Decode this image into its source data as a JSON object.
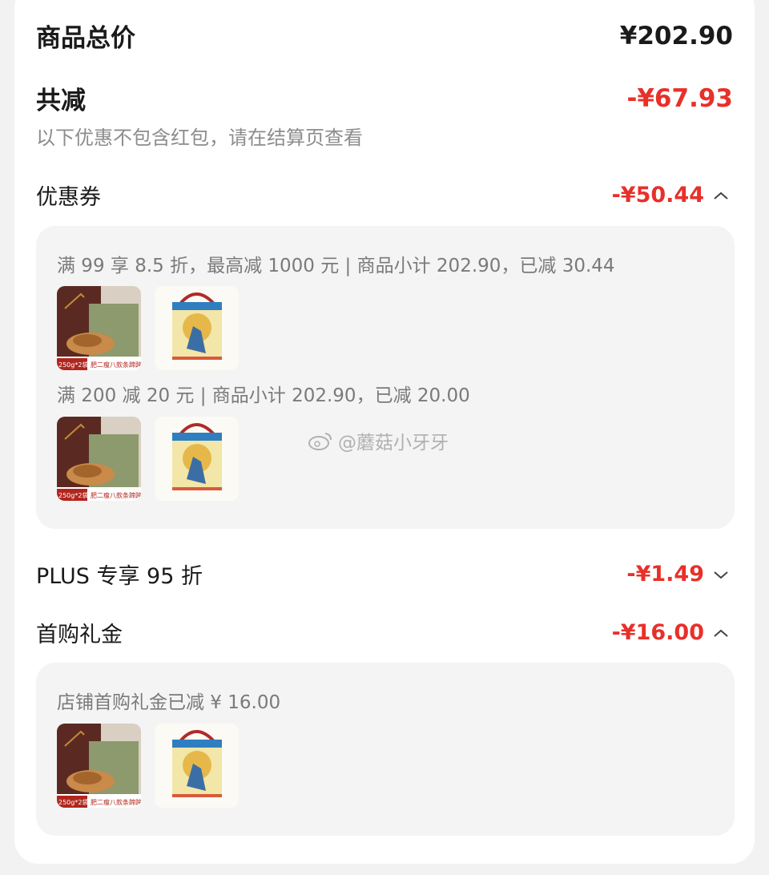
{
  "summary": {
    "total_label": "商品总价",
    "total_value": "¥202.90",
    "discount_label": "共减",
    "discount_value": "-¥67.93",
    "note": "以下优惠不包含红包，请在结算页查看"
  },
  "coupon": {
    "label": "优惠券",
    "value": "-¥50.44",
    "expanded": true,
    "rules": [
      {
        "text": "满 99 享 8.5 折，最高减 1000 元 | 商品小计 202.90，已减 30.44"
      },
      {
        "text": "满 200 减 20 元 | 商品小计 202.90，已减 20.00"
      }
    ]
  },
  "plus": {
    "label": "PLUS 专享 95 折",
    "value": "-¥1.49",
    "expanded": false
  },
  "first_purchase": {
    "label": "首购礼金",
    "value": "-¥16.00",
    "expanded": true,
    "rule": "店铺首购礼金已减 ¥ 16.00"
  },
  "products": [
    {
      "name": "snack-gift-bag",
      "badge": "250g*2袋",
      "caption": "肥二瘦八款条蹄跨"
    },
    {
      "name": "cookie-gift-box"
    }
  ],
  "watermark": "@蘑菇小牙牙",
  "colors": {
    "accent_red": "#e8302a",
    "text_gray": "#8c8c8c",
    "panel_bg": "#f4f4f4"
  }
}
